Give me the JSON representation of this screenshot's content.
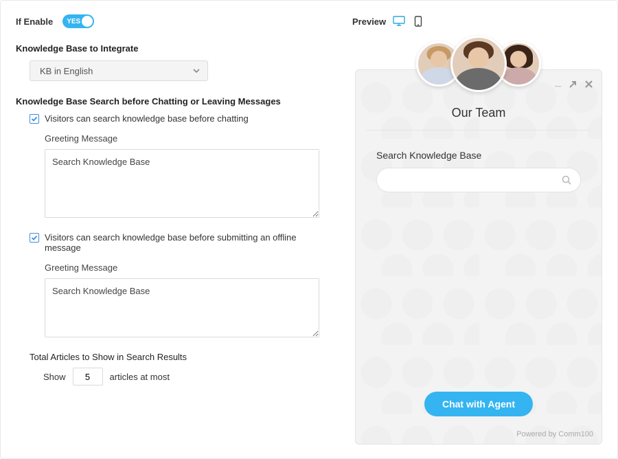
{
  "enable": {
    "label": "If Enable",
    "value": "YES"
  },
  "kb_integrate": {
    "label": "Knowledge Base to Integrate",
    "selected": "KB in English"
  },
  "kb_search": {
    "heading": "Knowledge Base Search before Chatting or Leaving Messages",
    "before_chat": {
      "label": "Visitors can search knowledge base before chatting",
      "greeting_label": "Greeting Message",
      "greeting_value": "Search Knowledge Base"
    },
    "before_offline": {
      "label": "Visitors can search knowledge base before submitting an offline message",
      "greeting_label": "Greeting Message",
      "greeting_value": "Search Knowledge Base"
    }
  },
  "total_articles": {
    "label": "Total Articles to Show in Search Results",
    "prefix": "Show",
    "value": "5",
    "suffix": "articles at most"
  },
  "preview": {
    "label": "Preview",
    "team_title": "Our Team",
    "kb_label": "Search Knowledge Base",
    "chat_button": "Chat with Agent",
    "powered": "Powered by Comm100"
  }
}
